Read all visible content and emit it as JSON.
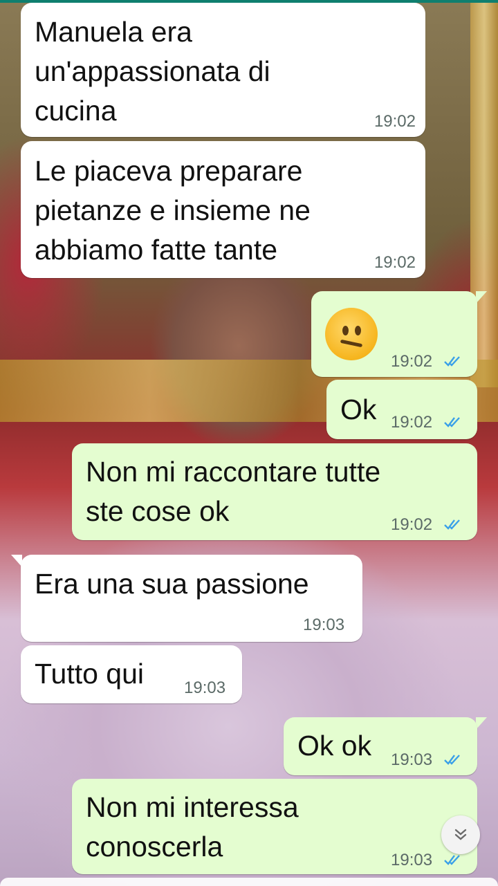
{
  "messages": [
    {
      "direction": "in",
      "lines": [
        "Manuela era",
        "un'appassionata di",
        "cucina"
      ],
      "time": "19:02"
    },
    {
      "direction": "in",
      "lines": [
        "Le piaceva preparare",
        "pietanze e insieme ne",
        "abbiamo fatte tante"
      ],
      "time": "19:02"
    },
    {
      "direction": "out",
      "emoji": "neutral-face",
      "time": "19:02",
      "status": "read-double-check"
    },
    {
      "direction": "out",
      "lines": [
        "Ok"
      ],
      "time": "19:02",
      "status": "read-double-check"
    },
    {
      "direction": "out",
      "lines": [
        "Non mi raccontare tutte",
        "ste cose ok"
      ],
      "time": "19:02",
      "status": "read-double-check"
    },
    {
      "direction": "in",
      "lines": [
        "Era una sua passione"
      ],
      "time": "19:03"
    },
    {
      "direction": "in",
      "lines": [
        "Tutto qui"
      ],
      "time": "19:03"
    },
    {
      "direction": "out",
      "lines": [
        "Ok ok"
      ],
      "time": "19:03",
      "status": "read-double-check"
    },
    {
      "direction": "out",
      "lines": [
        "Non mi interessa",
        "conoscerla"
      ],
      "time": "19:03",
      "status": "read-double-check"
    }
  ],
  "colors": {
    "incoming": "#ffffff",
    "outgoing": "#e4fdd0",
    "read_ticks": "#3aa0e8",
    "time": "#5b6a67"
  },
  "icons": {
    "scroll_down": "double-chevron-down-icon",
    "read_receipt": "double-check-icon"
  }
}
